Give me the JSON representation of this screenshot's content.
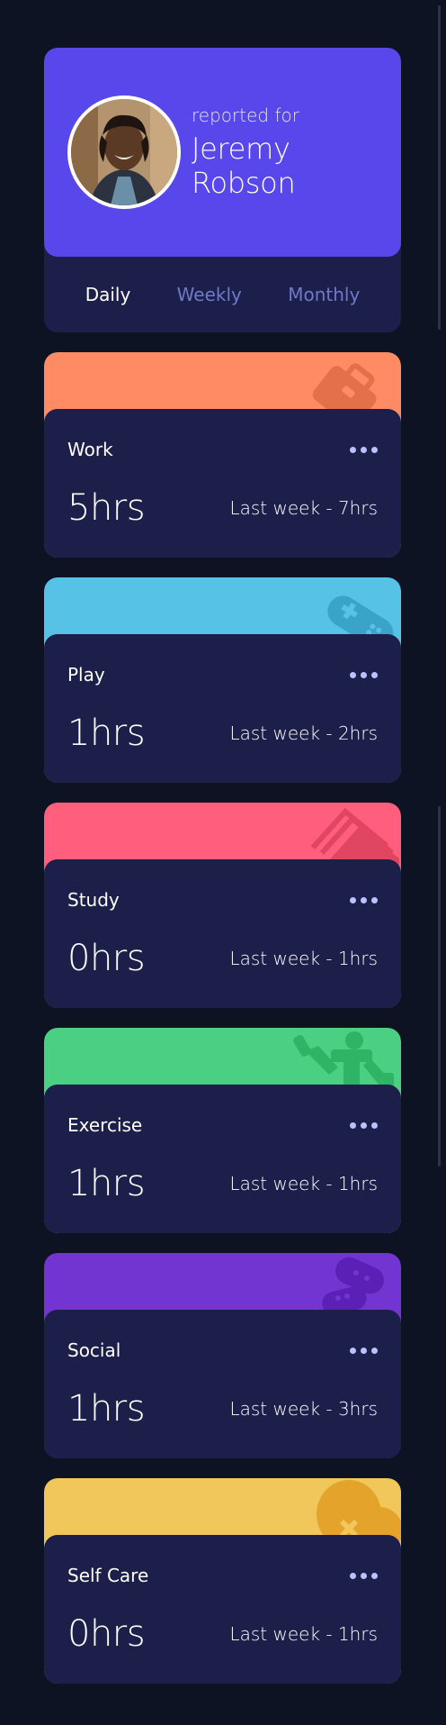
{
  "profile": {
    "reported_for": "reported for",
    "name": "Jeremy Robson",
    "avatar_icon": "avatar-photo"
  },
  "tabs": [
    {
      "label": "Daily",
      "active": true
    },
    {
      "label": "Weekly",
      "active": false
    },
    {
      "label": "Monthly",
      "active": false
    }
  ],
  "activities": [
    {
      "title": "Work",
      "current": "5hrs",
      "previous": "Last week - 7hrs",
      "color": "#ff8b64",
      "icon": "briefcase-icon"
    },
    {
      "title": "Play",
      "current": "1hrs",
      "previous": "Last week - 2hrs",
      "color": "#55c2e6",
      "icon": "game-controller-icon"
    },
    {
      "title": "Study",
      "current": "0hrs",
      "previous": "Last week - 1hrs",
      "color": "#ff5e7d",
      "icon": "books-icon"
    },
    {
      "title": "Exercise",
      "current": "1hrs",
      "previous": "Last week - 1hrs",
      "color": "#4bcf82",
      "icon": "exercise-icon"
    },
    {
      "title": "Social",
      "current": "1hrs",
      "previous": "Last week - 3hrs",
      "color": "#7335d2",
      "icon": "chat-bubbles-icon"
    },
    {
      "title": "Self Care",
      "current": "0hrs",
      "previous": "Last week - 1hrs",
      "color": "#f1c75b",
      "icon": "heart-icon"
    }
  ],
  "colors": {
    "background": "#0e1323",
    "card": "#1c1f4a",
    "profile_accent": "#5847eb",
    "tab_inactive": "#7078c9",
    "ellipsis": "#bbc0ff"
  }
}
